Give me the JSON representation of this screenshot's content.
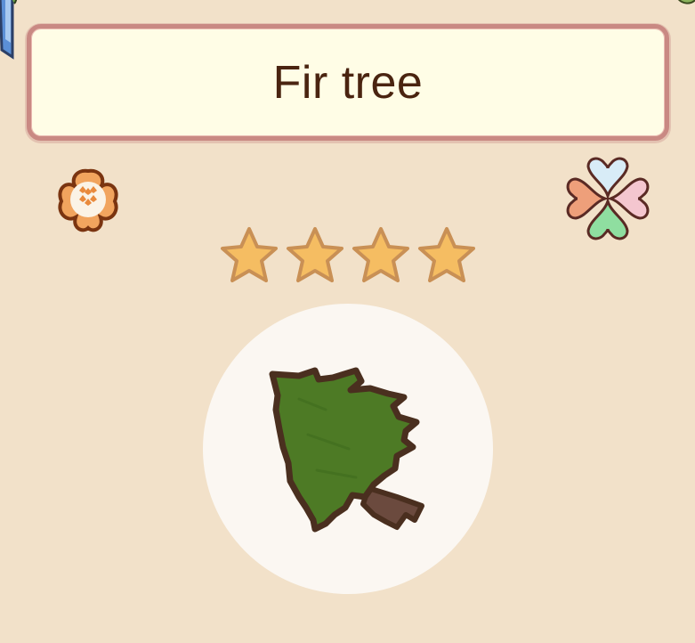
{
  "item": {
    "name": "Fir tree",
    "rarity_stars": 4,
    "rarity_max_stars": 4,
    "image_icon": "fir-tree-icon"
  },
  "badges": {
    "left_icon": "flower-icon",
    "right_icon": "clover-icon"
  },
  "colors": {
    "background": "#f2e1c9",
    "panel_fill": "#fffde6",
    "panel_border": "#c98983",
    "title_text": "#4a2410",
    "star_fill": "#f5bd62",
    "star_outline": "#c99055",
    "tree_green": "#4d7a25",
    "tree_outline": "#4a2f1f",
    "trunk": "#6b4a3e",
    "circle": "#fbf7f2"
  }
}
